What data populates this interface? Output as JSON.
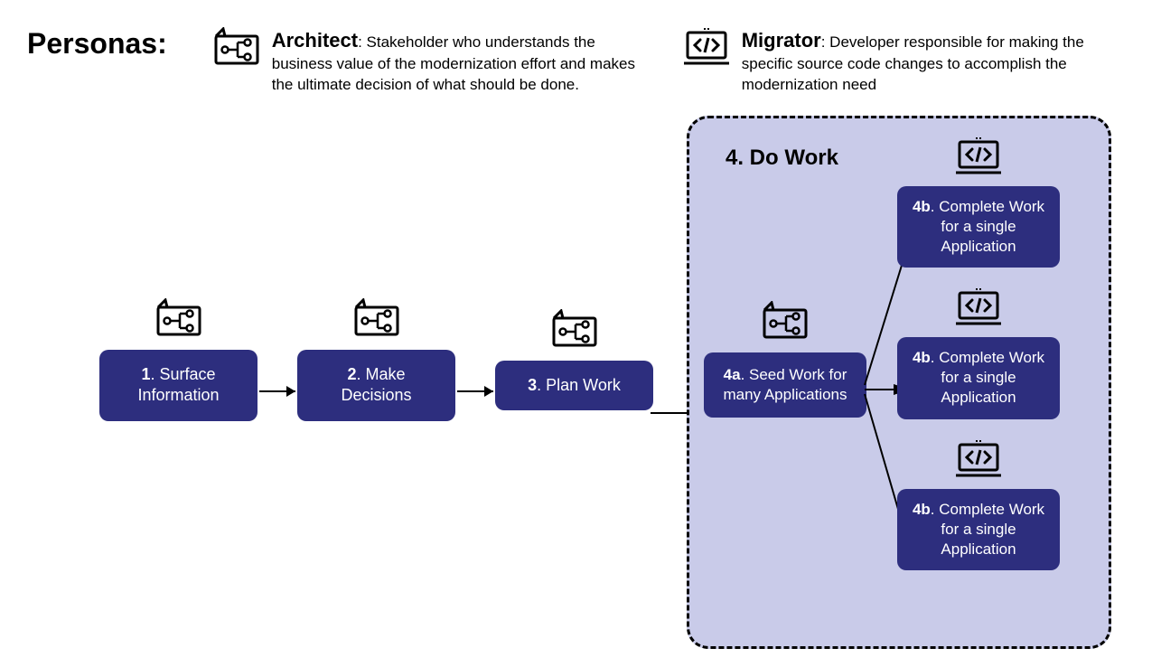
{
  "header": {
    "title": "Personas:",
    "architect": {
      "name": "Architect",
      "desc": ": Stakeholder who understands the business value of the modernization effort and makes the ultimate decision of what should be done."
    },
    "migrator": {
      "name": "Migrator",
      "desc": ": Developer responsible for making the specific source code changes to accomplish the modernization need"
    }
  },
  "steps": {
    "s1": {
      "num": "1",
      "label": ". Surface Information"
    },
    "s2": {
      "num": "2",
      "label": ". Make Decisions"
    },
    "s3": {
      "num": "3",
      "label": ". Plan Work"
    }
  },
  "dowork": {
    "title": "4. Do Work",
    "s4a": {
      "num": "4a",
      "label": ". Seed Work for many Applications"
    },
    "s4b": {
      "num": "4b",
      "label": ". Complete Work for a single Application"
    }
  },
  "colors": {
    "box": "#2d2e7e",
    "container_bg": "#c9cbe9"
  }
}
